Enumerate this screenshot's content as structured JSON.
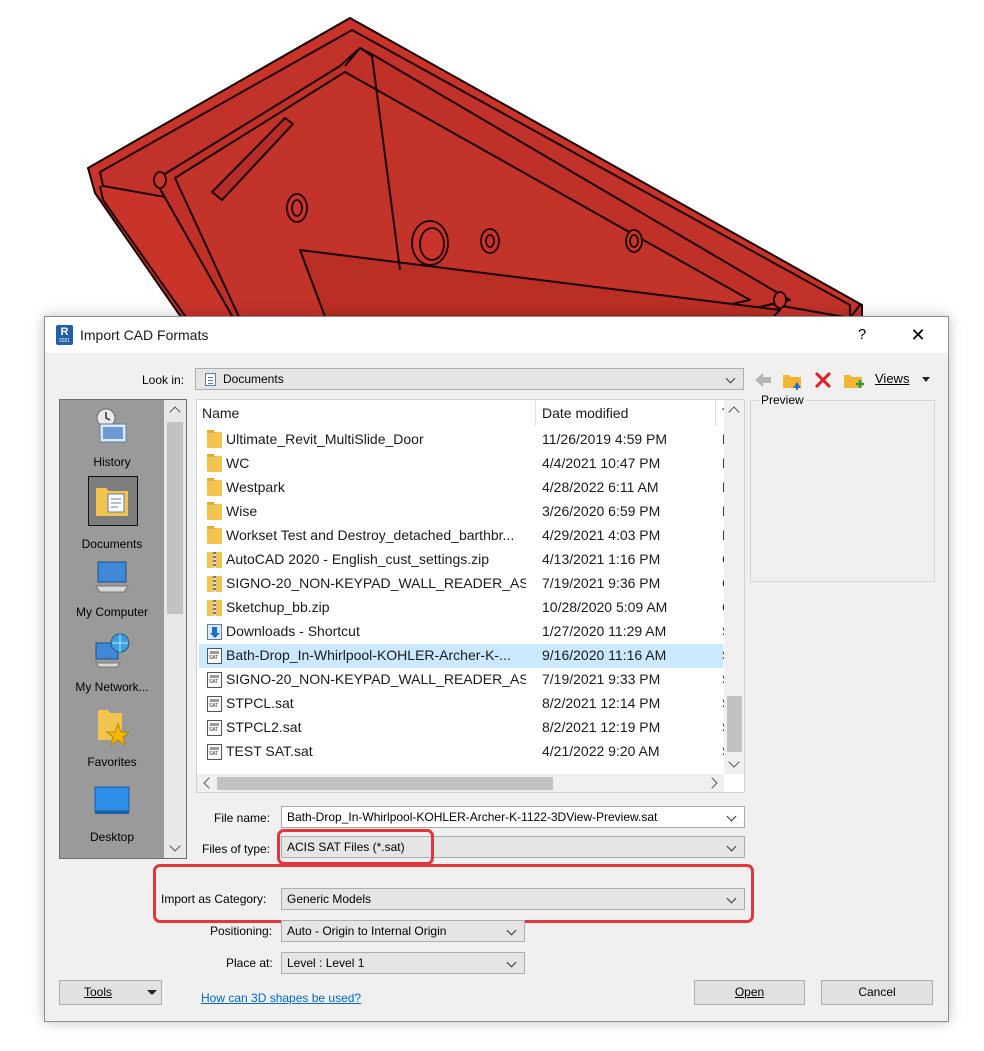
{
  "dialog": {
    "title": "Import CAD Formats",
    "app_icon_text": "R",
    "app_icon_sub": "2021",
    "help_glyph": "?",
    "close_glyph": "✕"
  },
  "look_in": {
    "label": "Look in:",
    "value": "Documents"
  },
  "toolbar": {
    "views_label": "Views"
  },
  "places": [
    {
      "label": "History",
      "icon": "history-icon"
    },
    {
      "label": "Documents",
      "icon": "documents-icon"
    },
    {
      "label": "My Computer",
      "icon": "computer-icon"
    },
    {
      "label": "My Network...",
      "icon": "network-icon"
    },
    {
      "label": "Favorites",
      "icon": "favorites-icon"
    },
    {
      "label": "Desktop",
      "icon": "desktop-icon"
    }
  ],
  "file_list": {
    "columns": [
      "Name",
      "Date modified",
      "T"
    ],
    "rows": [
      {
        "name": "Ultimate_Revit_MultiSlide_Door",
        "date": "11/26/2019 4:59 PM",
        "type": "F",
        "icon": "folder"
      },
      {
        "name": "WC",
        "date": "4/4/2021 10:47 PM",
        "type": "F",
        "icon": "folder"
      },
      {
        "name": "Westpark",
        "date": "4/28/2022 6:11 AM",
        "type": "F",
        "icon": "folder"
      },
      {
        "name": "Wise",
        "date": "3/26/2020 6:59 PM",
        "type": "F",
        "icon": "folder"
      },
      {
        "name": "Workset Test and Destroy_detached_barthbr...",
        "date": "4/29/2021 4:03 PM",
        "type": "F",
        "icon": "folder"
      },
      {
        "name": "AutoCAD 2020 - English_cust_settings.zip",
        "date": "4/13/2021 1:16 PM",
        "type": "C",
        "icon": "zip"
      },
      {
        "name": "SIGNO-20_NON-KEYPAD_WALL_READER_AS...",
        "date": "7/19/2021 9:36 PM",
        "type": "C",
        "icon": "zip"
      },
      {
        "name": "Sketchup_bb.zip",
        "date": "10/28/2020 5:09 AM",
        "type": "C",
        "icon": "zip"
      },
      {
        "name": "Downloads - Shortcut",
        "date": "1/27/2020 11:29 AM",
        "type": "S",
        "icon": "shortcut"
      },
      {
        "name": "Bath-Drop_In-Whirlpool-KOHLER-Archer-K-...",
        "date": "9/16/2020 11:16 AM",
        "type": "S",
        "icon": "sat",
        "selected": true
      },
      {
        "name": "SIGNO-20_NON-KEYPAD_WALL_READER_AS...",
        "date": "7/19/2021 9:33 PM",
        "type": "S",
        "icon": "sat"
      },
      {
        "name": "STPCL.sat",
        "date": "8/2/2021 12:14 PM",
        "type": "S",
        "icon": "sat"
      },
      {
        "name": "STPCL2.sat",
        "date": "8/2/2021 12:19 PM",
        "type": "S",
        "icon": "sat"
      },
      {
        "name": "TEST SAT.sat",
        "date": "4/21/2022 9:20 AM",
        "type": "S",
        "icon": "sat"
      }
    ]
  },
  "preview": {
    "label": "Preview"
  },
  "file_name": {
    "label": "File name:",
    "value": "Bath-Drop_In-Whirlpool-KOHLER-Archer-K-1122-3DView-Preview.sat"
  },
  "files_of_type": {
    "label": "Files of type:",
    "value": "ACIS SAT Files  (*.sat)"
  },
  "import_category": {
    "label": "Import as Category:",
    "value": "Generic Models"
  },
  "positioning": {
    "label": "Positioning:",
    "value": "Auto - Origin to Internal Origin"
  },
  "place_at": {
    "label": "Place at:",
    "value": "Level : Level 1"
  },
  "buttons": {
    "tools": "Tools",
    "open": "Open",
    "cancel": "Cancel"
  },
  "help_link": "How can 3D shapes be used?",
  "colors": {
    "model_fill": "#c8342a",
    "highlight": "#e3353c",
    "selection": "#cce8ff",
    "link": "#0066cc"
  }
}
